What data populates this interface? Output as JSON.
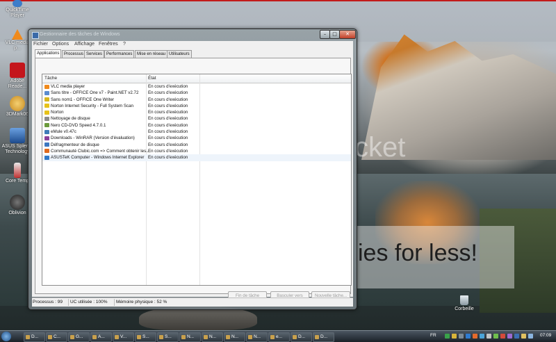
{
  "desktop": {
    "icons": [
      {
        "label": "QuickTime Player",
        "icon": "quicktime-icon",
        "color": "#3d7dc9"
      },
      {
        "label": "VLC media p...",
        "icon": "vlc-icon",
        "color": "#f08a1c"
      },
      {
        "label": "Adobe Reade...",
        "icon": "adobe-reader-icon",
        "color": "#c4161c"
      },
      {
        "label": "3DMark06",
        "icon": "3dmark-icon",
        "color": "#e0a93b"
      },
      {
        "label": "ASUS Splen... Technology",
        "icon": "asus-splendid-icon",
        "color": "#2d66b3"
      },
      {
        "label": "Core Temp",
        "icon": "core-temp-icon",
        "color": "#c9c9c9"
      },
      {
        "label": "Oblivion",
        "icon": "oblivion-icon",
        "color": "#3b3b3b"
      }
    ],
    "watermark_top": "cket",
    "watermark_banner": "ies for less!",
    "recycle_bin_label": "Corbeille"
  },
  "window": {
    "title": "Gestionnaire des tâches de Windows",
    "controls": {
      "minimize": "–",
      "maximize": "□",
      "close": "✕"
    },
    "menu": [
      "Fichier",
      "Options",
      "Affichage",
      "Fenêtres",
      "?"
    ],
    "tabs": [
      "Applications",
      "Processus",
      "Services",
      "Performances",
      "Mise en réseau",
      "Utilisateurs"
    ],
    "active_tab": "Applications",
    "list": {
      "columns": [
        "Tâche",
        "État"
      ],
      "rows": [
        {
          "task": "VLC media player",
          "status": "En cours d'exécution",
          "icon": "vlc-icon",
          "color": "#f08a1c",
          "selected": false
        },
        {
          "task": "Sans titre - OFFICE One v7 - Paint.NET v2.72",
          "status": "En cours d'exécution",
          "icon": "paintnet-icon",
          "color": "#5a8bd0",
          "selected": false
        },
        {
          "task": "Sans nom1 - OFFICE One Writer",
          "status": "En cours d'exécution",
          "icon": "writer-icon",
          "color": "#d7b61e",
          "selected": false
        },
        {
          "task": "Norton Internet Security - Full System Scan",
          "status": "En cours d'exécution",
          "icon": "norton-icon",
          "color": "#e6c21a",
          "selected": false
        },
        {
          "task": "Norton",
          "status": "En cours d'exécution",
          "icon": "norton-icon",
          "color": "#e6c21a",
          "selected": false
        },
        {
          "task": "Nettoyage de disque",
          "status": "En cours d'exécution",
          "icon": "disk-cleanup-icon",
          "color": "#8c8c8c",
          "selected": false
        },
        {
          "task": "Nero CD-DVD Speed 4.7.0.1",
          "status": "En cours d'exécution",
          "icon": "nero-icon",
          "color": "#6b9a3c",
          "selected": false
        },
        {
          "task": "eMule v0.47c",
          "status": "En cours d'exécution",
          "icon": "emule-icon",
          "color": "#3e7bb8",
          "selected": false
        },
        {
          "task": "Downloads - WinRAR (Version d'évaluation)",
          "status": "En cours d'exécution",
          "icon": "winrar-icon",
          "color": "#8a3f9a",
          "selected": false
        },
        {
          "task": "Défragmenteur de disque",
          "status": "En cours d'exécution",
          "icon": "defrag-icon",
          "color": "#3c77c0",
          "selected": false
        },
        {
          "task": "Communauté Clubic.com => Comment obtenir les...",
          "status": "En cours d'exécution",
          "icon": "firefox-icon",
          "color": "#e06a1e",
          "selected": false
        },
        {
          "task": "ASUSTeK Computer - Windows Internet Explorer",
          "status": "En cours d'exécution",
          "icon": "ie-icon",
          "color": "#2f78c8",
          "selected": true
        }
      ]
    },
    "buttons": [
      "Fin de tâche",
      "Basculer vers",
      "Nouvelle tâche..."
    ],
    "statusbar": {
      "processes": "Processus : 99",
      "cpu": "UC utilisée : 100%",
      "memory": "Mémoire physique : 52 %"
    }
  },
  "taskbar": {
    "items": [
      "D...",
      "C...",
      "G...",
      "A...",
      "V...",
      "S...",
      "S...",
      "N...",
      "N...",
      "N...",
      "N...",
      "e...",
      "D...",
      "D..."
    ],
    "language": "FR",
    "clock": "07:09"
  }
}
